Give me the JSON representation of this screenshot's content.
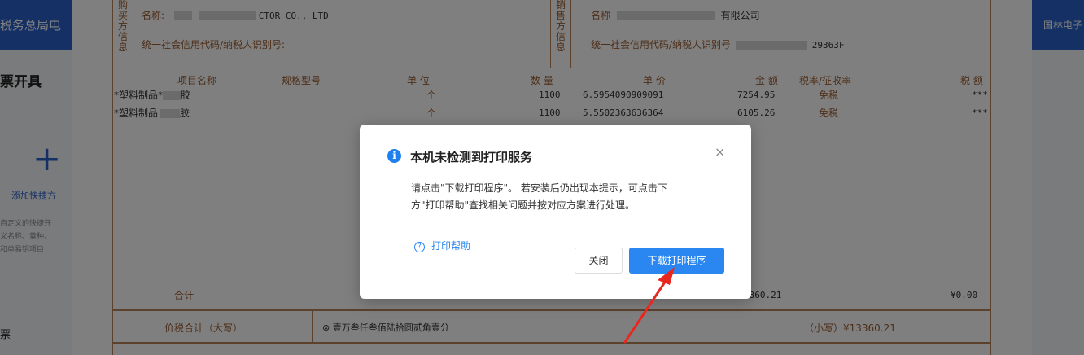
{
  "app": {
    "header_title_left": "税务总局电",
    "header_title_right": "国林电子",
    "page_title": "票开具",
    "add_quick_label": "添加快捷方",
    "quick_desc_lines": [
      "自定义的快捷开",
      "义名称、蓋种、",
      "和单易钥项目"
    ],
    "bottom_label": "票"
  },
  "invoice": {
    "buyer_label_chars": [
      "购",
      "买",
      "方",
      "信",
      "息"
    ],
    "buyer_name_label": "名称:",
    "buyer_name_value": "CTOR  CO., LTD",
    "buyer_tax_label": "统一社会信用代码/纳税人识别号:",
    "seller_label_chars": [
      "销",
      "售",
      "方",
      "信",
      "息"
    ],
    "seller_name_label": "名称",
    "seller_name_value": "有限公司",
    "seller_tax_label": "统一社会信用代码/纳税人识别号",
    "seller_tax_value": "29363F",
    "columns": [
      "项目名称",
      "规格型号",
      "单 位",
      "数 量",
      "单 价",
      "金 额",
      "税率/征收率",
      "税 额"
    ],
    "rows": [
      {
        "name": "*塑料制品*",
        "name_tail": "胶",
        "unit": "个",
        "qty": "1100",
        "price": "6.5954090909091",
        "amount": "7254.95",
        "rate": "免税",
        "tax": "***"
      },
      {
        "name": "*塑料制品",
        "name_tail": "胶",
        "unit": "个",
        "qty": "1100",
        "price": "5.5502363636364",
        "amount": "6105.26",
        "rate": "免税",
        "tax": "***"
      }
    ],
    "total_label": "合计",
    "total_amount": "3360.21",
    "total_tax": "¥0.00",
    "grand_label": "价税合计（大写）",
    "grand_upper": "⊗ 壹万叁仟叁佰陆拾圆贰角壹分",
    "grand_lower": "（小写）¥13360.21"
  },
  "modal": {
    "info_icon": "i",
    "title": "本机未检测到打印服务",
    "close_icon": "×",
    "body_line1": "请点击\"下载打印程序\"。 若安装后仍出现本提示，可点击下",
    "body_line2": "方\"打印帮助\"查找相关问题并按对应方案进行处理。",
    "help_icon": "?",
    "help_label": "打印帮助",
    "close_button": "关闭",
    "download_button": "下载打印程序"
  },
  "colors": {
    "accent_blue": "#2a86f0",
    "header_blue": "#2a60c8",
    "invoice_brown": "#9a5c30",
    "arrow_red": "#e8281f"
  }
}
